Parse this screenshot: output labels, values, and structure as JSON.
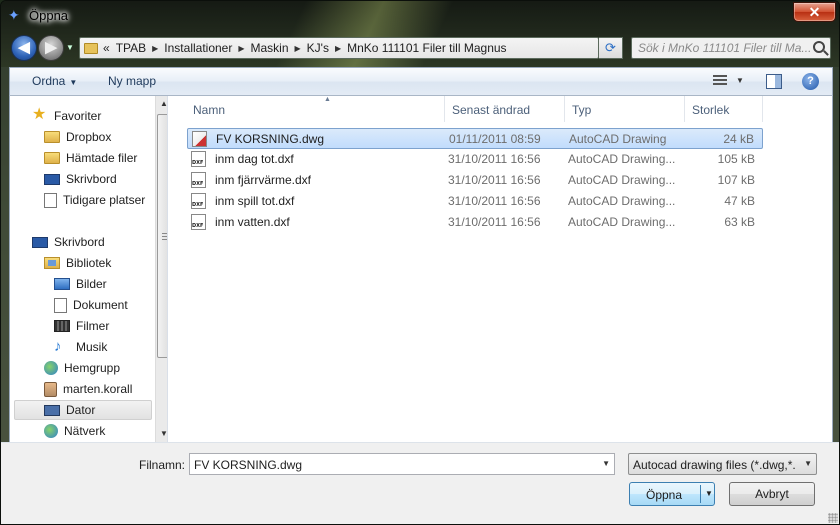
{
  "window": {
    "title": "Öppna",
    "close_label": "✕"
  },
  "address": {
    "prefix": "«",
    "crumbs": [
      "TPAB",
      "Installationer",
      "Maskin",
      "KJ's",
      "MnKo 111101 Filer till Magnus"
    ]
  },
  "search": {
    "placeholder": "Sök i MnKo 111101 Filer till Ma..."
  },
  "toolbar": {
    "organize_label": "Ordna",
    "new_folder_label": "Ny mapp"
  },
  "navpane": {
    "items": [
      {
        "label": "Favoriter",
        "icon": "star-icon"
      },
      {
        "label": "Dropbox",
        "icon": "folder-icon"
      },
      {
        "label": "Hämtade filer",
        "icon": "folder-icon"
      },
      {
        "label": "Skrivbord",
        "icon": "desktop-icon"
      },
      {
        "label": "Tidigare platser",
        "icon": "recent-places-icon"
      },
      {
        "label": "Skrivbord",
        "icon": "desktop-icon"
      },
      {
        "label": "Bibliotek",
        "icon": "library-icon"
      },
      {
        "label": "Bilder",
        "icon": "pictures-icon"
      },
      {
        "label": "Dokument",
        "icon": "documents-icon"
      },
      {
        "label": "Filmer",
        "icon": "videos-icon"
      },
      {
        "label": "Musik",
        "icon": "music-icon"
      },
      {
        "label": "Hemgrupp",
        "icon": "homegroup-icon"
      },
      {
        "label": "marten.korall",
        "icon": "user-icon"
      },
      {
        "label": "Dator",
        "icon": "computer-icon"
      },
      {
        "label": "Nätverk",
        "icon": "network-icon"
      }
    ]
  },
  "columns": {
    "name": "Namn",
    "modified": "Senast ändrad",
    "type": "Typ",
    "size": "Storlek"
  },
  "files": [
    {
      "name": "FV KORSNING.dwg",
      "modified": "01/11/2011 08:59",
      "type": "AutoCAD Drawing",
      "size": "24 kB",
      "selected": true
    },
    {
      "name": "inm dag tot.dxf",
      "modified": "31/10/2011 16:56",
      "type": "AutoCAD Drawing...",
      "size": "105 kB"
    },
    {
      "name": "inm fjärrvärme.dxf",
      "modified": "31/10/2011 16:56",
      "type": "AutoCAD Drawing...",
      "size": "107 kB"
    },
    {
      "name": "inm spill tot.dxf",
      "modified": "31/10/2011 16:56",
      "type": "AutoCAD Drawing...",
      "size": "47 kB"
    },
    {
      "name": "inm vatten.dxf",
      "modified": "31/10/2011 16:56",
      "type": "AutoCAD Drawing...",
      "size": "63 kB"
    }
  ],
  "footer": {
    "filename_label": "Filnamn:",
    "filename_value": "FV KORSNING.dwg",
    "filter_value": "Autocad drawing files (*.dwg,*.",
    "open_label": "Öppna",
    "cancel_label": "Avbryt"
  }
}
